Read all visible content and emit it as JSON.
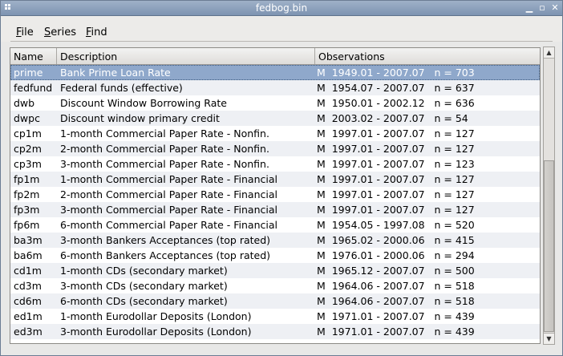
{
  "window": {
    "title": "fedbog.bin",
    "controls": {
      "minimize": "▁",
      "maximize": "▫",
      "close": "✕"
    }
  },
  "menu": [
    {
      "accel": "F",
      "rest": "ile"
    },
    {
      "accel": "S",
      "rest": "eries"
    },
    {
      "accel": "F",
      "rest": "ind"
    }
  ],
  "table": {
    "columns": [
      "Name",
      "Description",
      "Observations"
    ],
    "selected_index": 0,
    "rows": [
      {
        "name": "prime",
        "desc": "Bank Prime Loan Rate",
        "obs": "M  1949.01 - 2007.07   n = 703"
      },
      {
        "name": "fedfund",
        "desc": "Federal funds (effective)",
        "obs": "M  1954.07 - 2007.07   n = 637"
      },
      {
        "name": "dwb",
        "desc": "Discount Window Borrowing Rate",
        "obs": "M  1950.01 - 2002.12   n = 636"
      },
      {
        "name": "dwpc",
        "desc": "Discount window primary credit",
        "obs": "M  2003.02 - 2007.07   n = 54"
      },
      {
        "name": "cp1m",
        "desc": "1-month Commercial Paper Rate - Nonfin.",
        "obs": "M  1997.01 - 2007.07   n = 127"
      },
      {
        "name": "cp2m",
        "desc": "2-month Commercial Paper Rate - Nonfin.",
        "obs": "M  1997.01 - 2007.07   n = 127"
      },
      {
        "name": "cp3m",
        "desc": "3-month Commercial Paper Rate - Nonfin.",
        "obs": "M  1997.01 - 2007.07   n = 123"
      },
      {
        "name": "fp1m",
        "desc": "1-month Commercial Paper Rate - Financial",
        "obs": "M  1997.01 - 2007.07   n = 127"
      },
      {
        "name": "fp2m",
        "desc": "2-month Commercial Paper Rate - Financial",
        "obs": "M  1997.01 - 2007.07   n = 127"
      },
      {
        "name": "fp3m",
        "desc": "3-month Commercial Paper Rate - Financial",
        "obs": "M  1997.01 - 2007.07   n = 127"
      },
      {
        "name": "fp6m",
        "desc": "6-month Commercial Paper Rate - Financial",
        "obs": "M  1954.05 - 1997.08   n = 520"
      },
      {
        "name": "ba3m",
        "desc": "3-month Bankers Acceptances (top rated)",
        "obs": "M  1965.02 - 2000.06   n = 415"
      },
      {
        "name": "ba6m",
        "desc": "6-month Bankers Acceptances (top rated)",
        "obs": "M  1976.01 - 2000.06   n = 294"
      },
      {
        "name": "cd1m",
        "desc": "1-month CDs (secondary market)",
        "obs": "M  1965.12 - 2007.07   n = 500"
      },
      {
        "name": "cd3m",
        "desc": "3-month CDs (secondary market)",
        "obs": "M  1964.06 - 2007.07   n = 518"
      },
      {
        "name": "cd6m",
        "desc": "6-month CDs (secondary market)",
        "obs": "M  1964.06 - 2007.07   n = 518"
      },
      {
        "name": "ed1m",
        "desc": "1-month Eurodollar Deposits (London)",
        "obs": "M  1971.01 - 2007.07   n = 439"
      },
      {
        "name": "ed3m",
        "desc": "3-month Eurodollar Deposits (London)",
        "obs": "M  1971.01 - 2007.07   n = 439"
      }
    ]
  },
  "scrollbar": {
    "up_arrow": "▲",
    "down_arrow": "▼"
  }
}
